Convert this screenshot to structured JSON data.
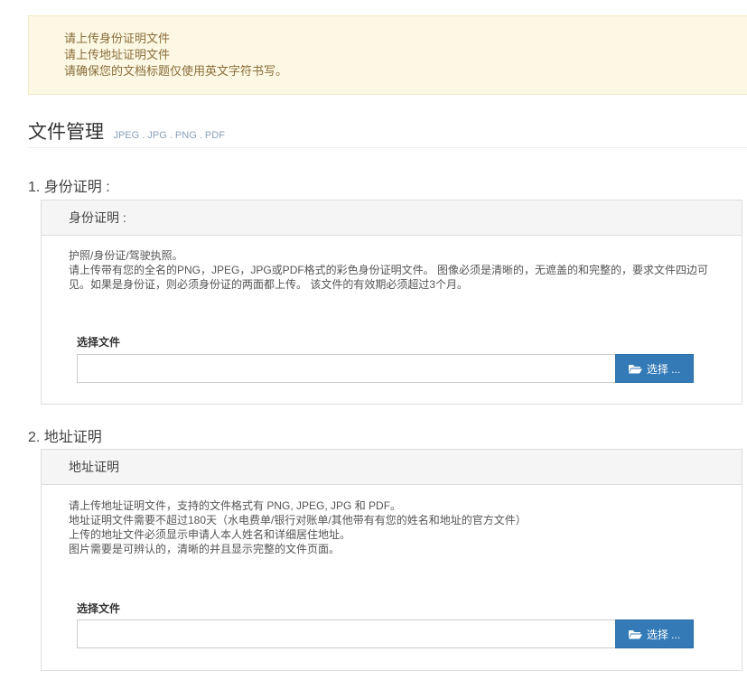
{
  "notice": {
    "lines": [
      "请上传身份证明文件",
      "请上传地址证明文件",
      "请确保您的文档标题仅使用英文字符书写。"
    ]
  },
  "page_title": {
    "main": "文件管理",
    "formats": "JPEG . JPG . PNG . PDF"
  },
  "sections": [
    {
      "heading": "1. 身份证明 :",
      "panel_title": "身份证明 :",
      "description": [
        "护照/身份证/驾驶执照。",
        "请上传带有您的全名的PNG，JPEG，JPG或PDF格式的彩色身份证明文件。 图像必须是清晰的，无遮盖的和完整的，要求文件四边可见。如果是身份证，则必须身份证的两面都上传。 该文件的有效期必须超过3个月。"
      ],
      "file_label": "选择文件",
      "file_value": "",
      "button_label": "选择 ..."
    },
    {
      "heading": "2. 地址证明",
      "panel_title": "地址证明",
      "description": [
        "请上传地址证明文件，支持的文件格式有 PNG, JPEG, JPG 和 PDF。",
        "地址证明文件需要不超过180天（水电费单/银行对账单/其他带有有您的姓名和地址的官方文件）",
        "上传的地址文件必须显示申请人本人姓名和详细居住地址。",
        "图片需要是可辨认的，清晰的并且显示完整的文件页面。"
      ],
      "file_label": "选择文件",
      "file_value": "",
      "button_label": "选择 ..."
    }
  ],
  "colors": {
    "notice_bg": "#fcf8e3",
    "notice_text": "#8a6d3b",
    "button_bg": "#337ab7",
    "formats_text": "#8aa0b8"
  },
  "icons": {
    "button_icon": "folder-open-icon"
  }
}
